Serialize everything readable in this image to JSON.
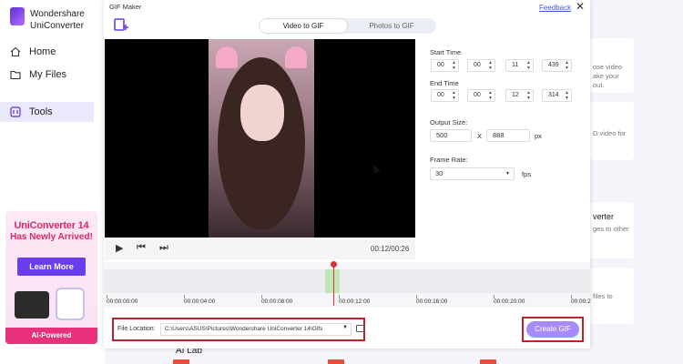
{
  "app": {
    "brand_line1": "Wondershare",
    "brand_line2": "UniConverter"
  },
  "sidebar": {
    "items": [
      {
        "label": "Home",
        "icon": "home-icon"
      },
      {
        "label": "My Files",
        "icon": "files-icon"
      },
      {
        "label": "Tools",
        "icon": "tools-icon",
        "active": true
      }
    ],
    "promo": {
      "title": "UniConverter 14",
      "subtitle": "Has Newly Arrived!",
      "button": "Learn More",
      "badge": "AI-Powered"
    }
  },
  "background": {
    "texts": [
      "ose video",
      "ake your",
      "out.",
      "D video for",
      "verter",
      "ges to other",
      "files to"
    ],
    "ai_lab": "AI Lab"
  },
  "dialog": {
    "title": "GIF Maker",
    "feedback": "Feedback",
    "close": "✕",
    "tabs": [
      {
        "label": "Video to GIF",
        "active": true
      },
      {
        "label": "Photos to GIF",
        "active": false
      }
    ],
    "player": {
      "timecode": "00:12/00:26"
    },
    "settings": {
      "start_label": "Start Time",
      "start": [
        "00",
        "00",
        "11",
        "439"
      ],
      "end_label": "End Time",
      "end": [
        "00",
        "00",
        "12",
        "314"
      ],
      "output_label": "Output Size:",
      "width": "500",
      "x": "X",
      "height": "888",
      "px": "px",
      "frame_label": "Frame Rate:",
      "frame_rate": "30",
      "fps": "fps"
    },
    "timeline": {
      "ticks": [
        "00:00:00:00",
        "00:00:04:00",
        "00:00:08:00",
        "00:00:12:00",
        "00:00:16:00",
        "00:00:20:00",
        "00:00:2"
      ]
    },
    "bottom": {
      "file_location_label": "File Location:",
      "path": "C:\\Users\\ASUS\\Pictures\\Wondershare UniConverter 14\\Gifs",
      "create_button": "Create GIF"
    }
  },
  "colors": {
    "accent": "#6b3df0",
    "create": "#a78bfa",
    "highlight": "#c0202a",
    "promo": "#e0246d"
  }
}
